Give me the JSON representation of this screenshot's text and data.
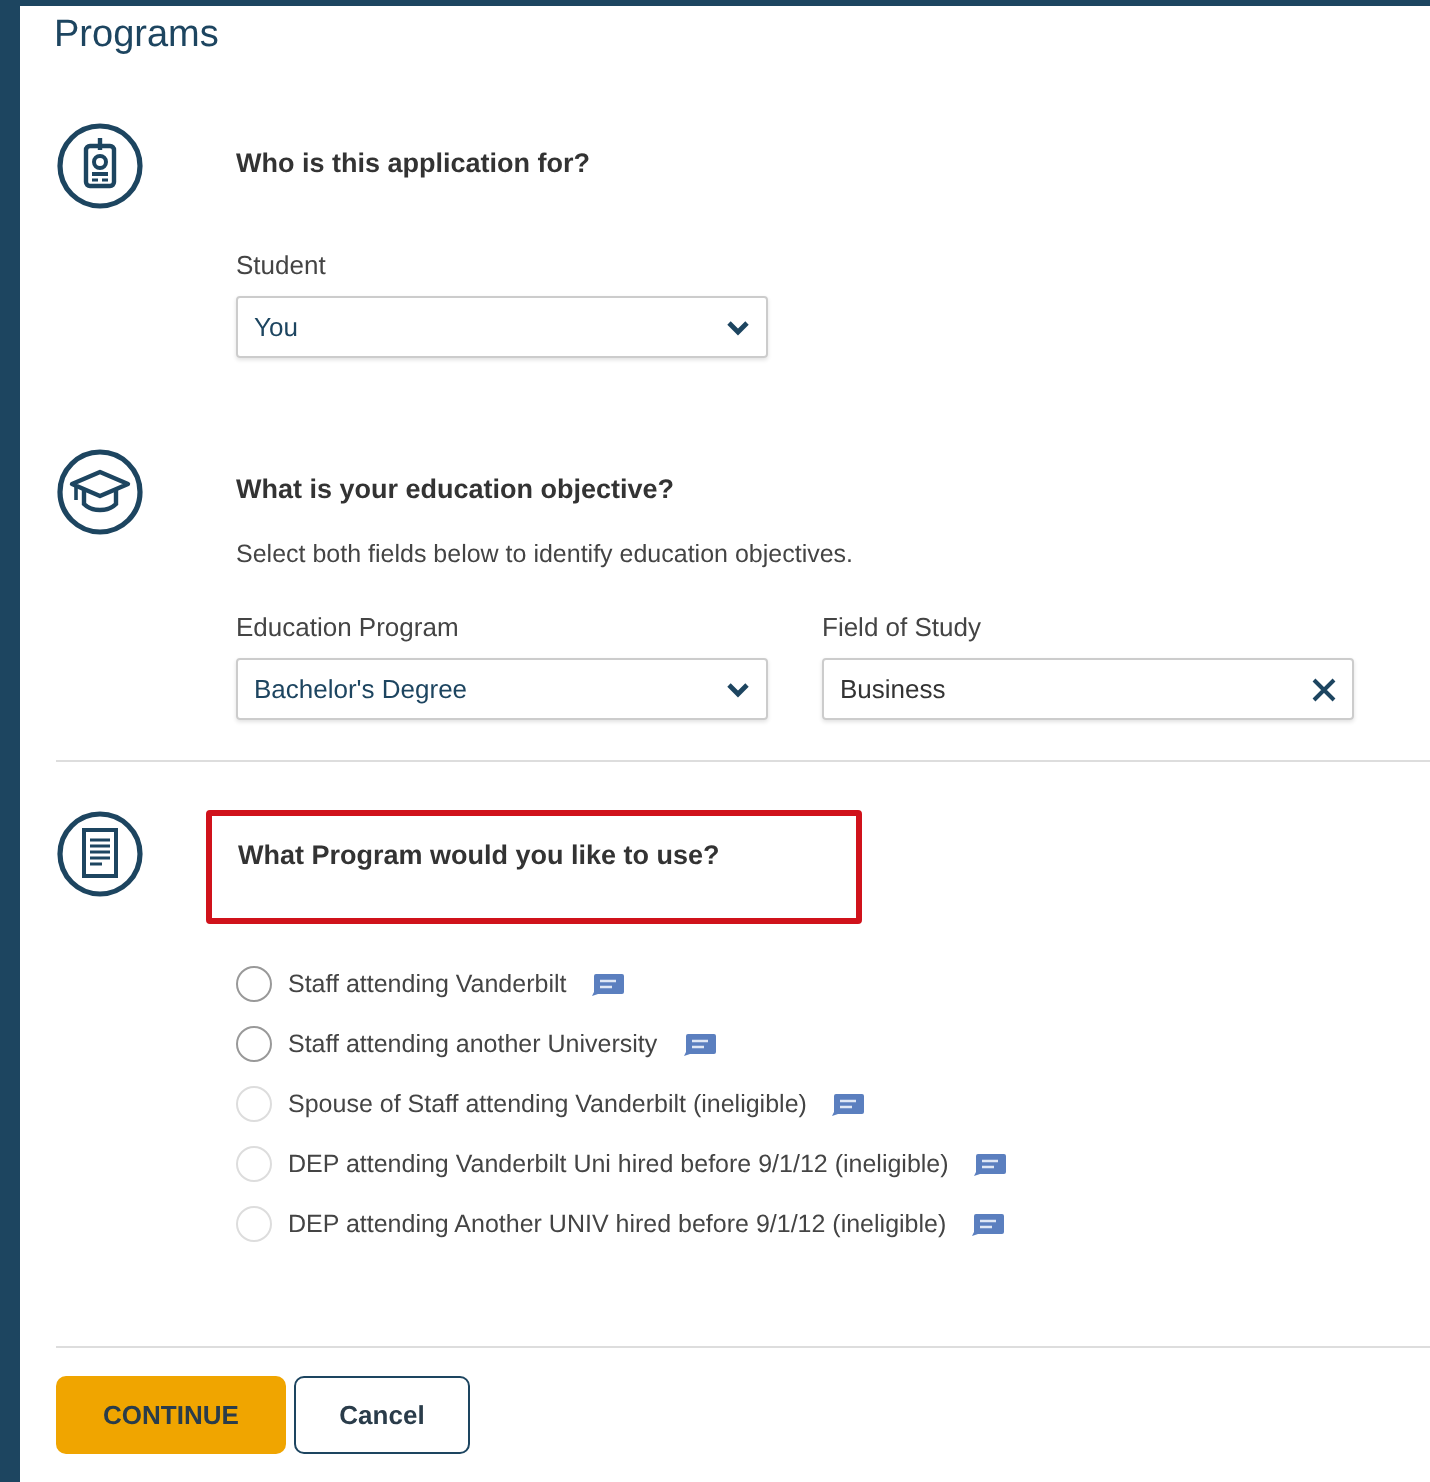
{
  "page_title": "Programs",
  "sections": [
    {
      "kind": "person",
      "question": "Who is this application for?",
      "highlighted": false,
      "fields": [
        {
          "kind": "select",
          "label": "Student",
          "value": "You"
        }
      ]
    },
    {
      "kind": "education",
      "question": "What is your education objective?",
      "highlighted": false,
      "hint": "Select both fields below to identify education objectives.",
      "fields": [
        {
          "kind": "select",
          "label": "Education Program",
          "value": "Bachelor's Degree"
        },
        {
          "kind": "clearable",
          "label": "Field of Study",
          "value": "Business"
        }
      ]
    },
    {
      "kind": "program",
      "question": "What Program would you like to use?",
      "highlighted": true,
      "options": [
        {
          "label": "Staff attending Vanderbilt",
          "selected": false,
          "disabled": false
        },
        {
          "label": "Staff attending another University",
          "selected": false,
          "disabled": false
        },
        {
          "label": "Spouse of Staff attending Vanderbilt (ineligible)",
          "selected": false,
          "disabled": true
        },
        {
          "label": "DEP attending Vanderbilt Uni hired before 9/1/12 (ineligible)",
          "selected": false,
          "disabled": true
        },
        {
          "label": "DEP attending Another UNIV hired before 9/1/12 (ineligible)",
          "selected": false,
          "disabled": true
        }
      ]
    }
  ],
  "buttons": [
    {
      "kind": "primary",
      "label": "CONTINUE"
    },
    {
      "kind": "secondary",
      "label": "Cancel"
    }
  ]
}
